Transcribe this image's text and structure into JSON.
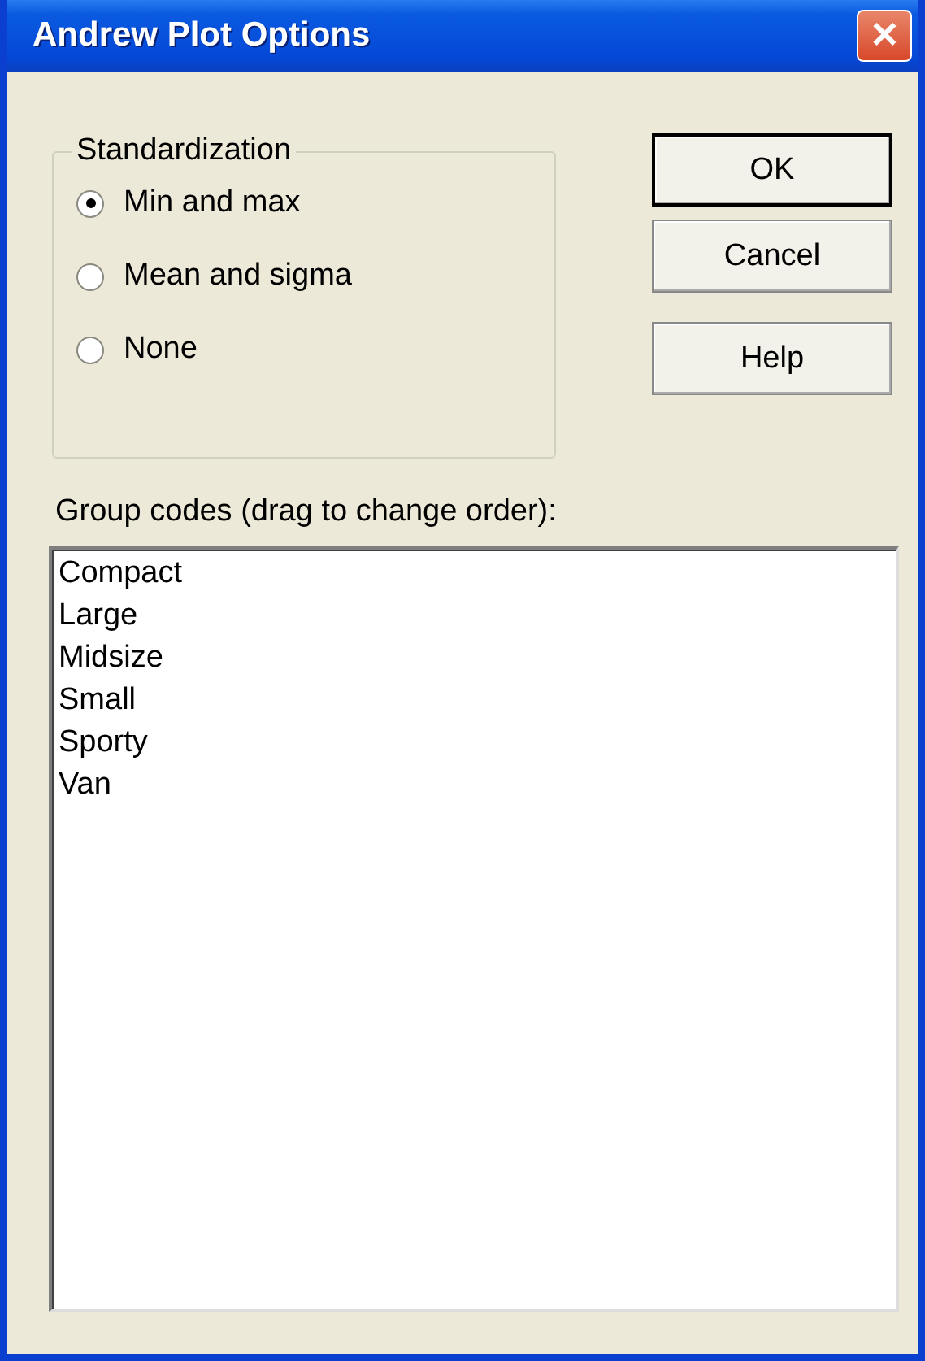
{
  "window": {
    "title": "Andrew Plot Options",
    "close": "✕"
  },
  "standardization": {
    "title": "Standardization",
    "options": [
      {
        "label": "Min and max",
        "selected": true
      },
      {
        "label": "Mean and sigma",
        "selected": false
      },
      {
        "label": "None",
        "selected": false
      }
    ]
  },
  "buttons": [
    "OK",
    "Cancel",
    "Help"
  ],
  "group_codes": {
    "label": "Group codes (drag to change order):",
    "items": [
      "Compact",
      "Large",
      "Midsize",
      "Small",
      "Sporty",
      "Van"
    ]
  }
}
